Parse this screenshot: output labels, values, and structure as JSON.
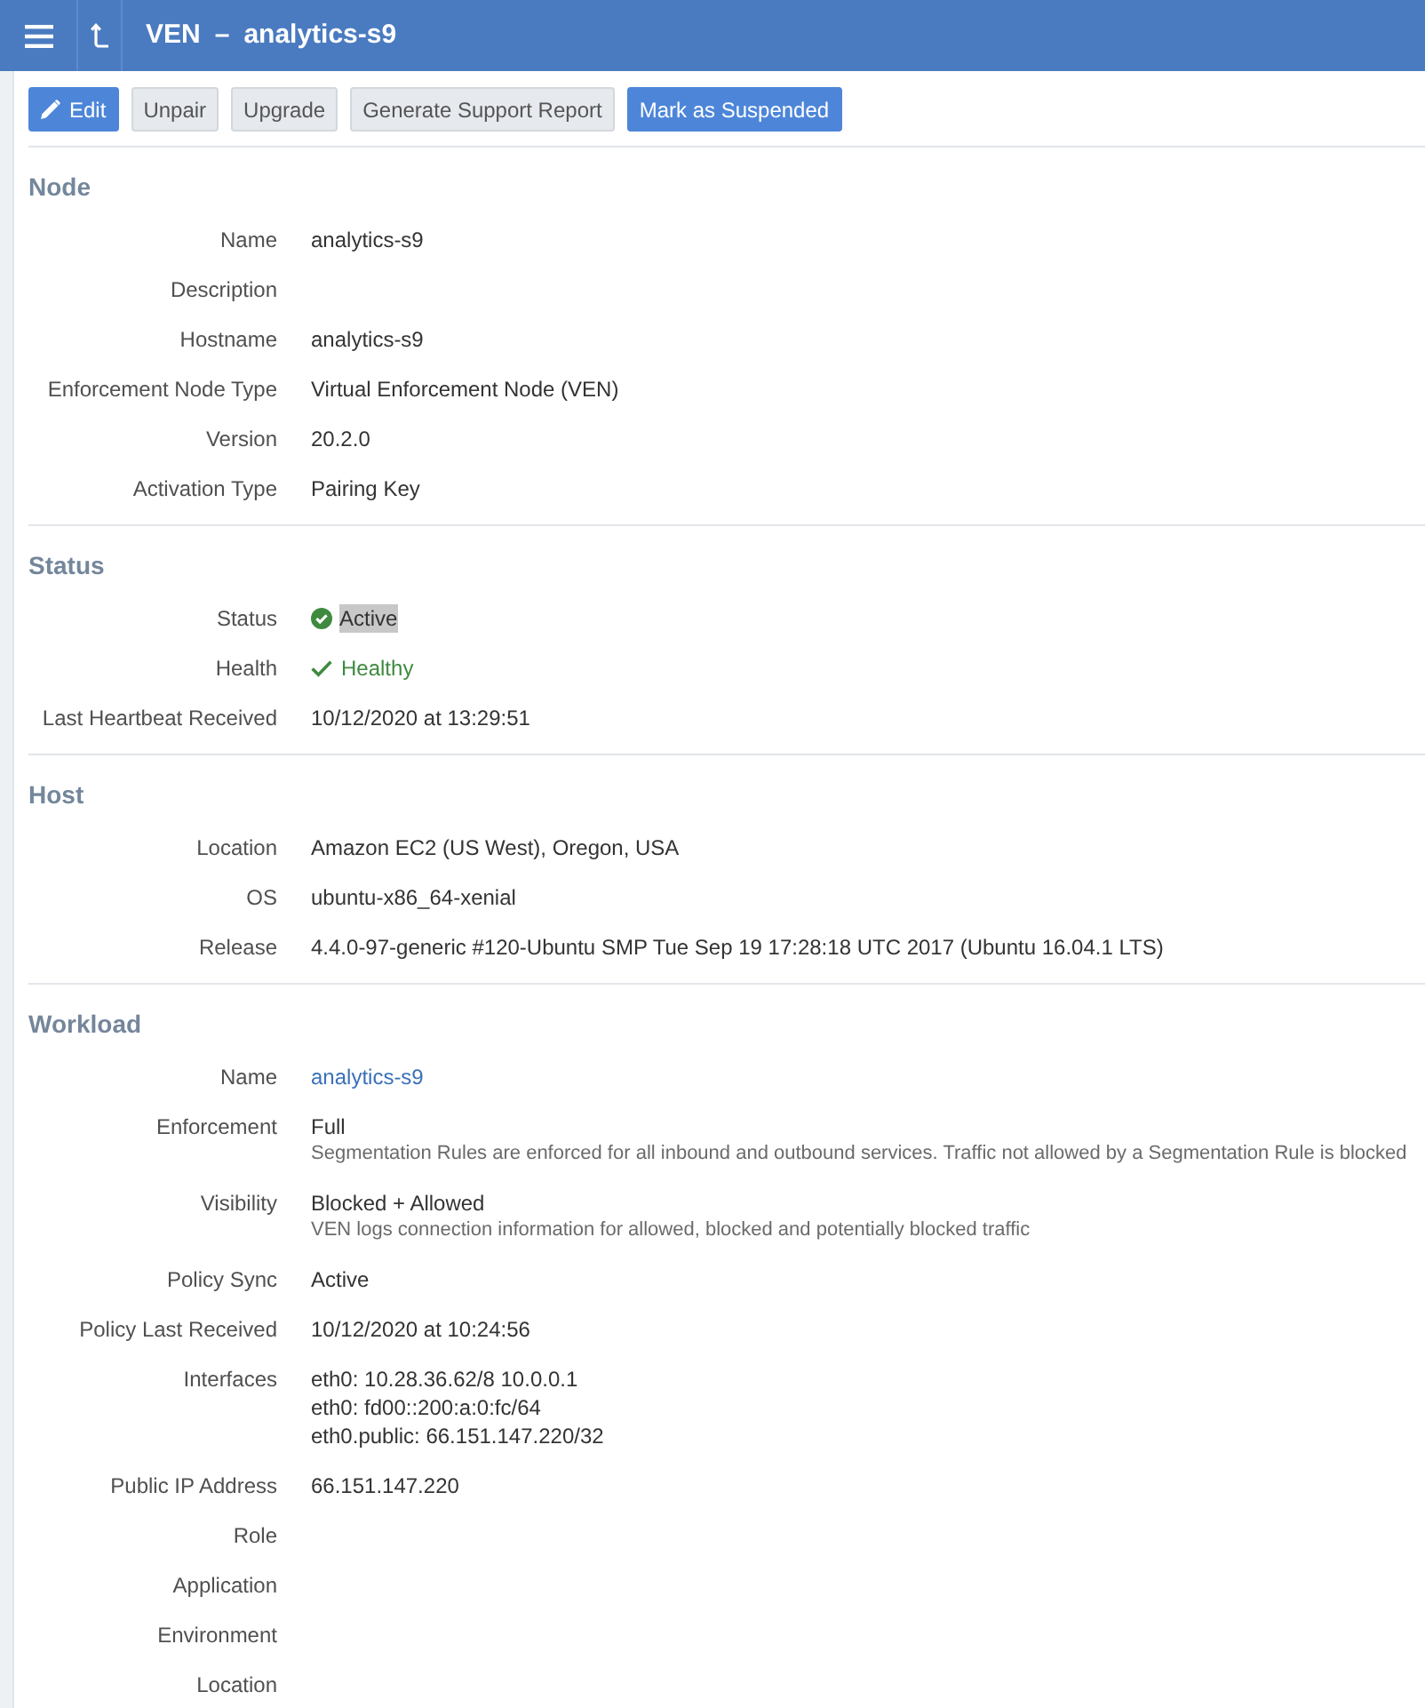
{
  "header": {
    "title": "VEN",
    "separator": "–",
    "subtitle": "analytics-s9"
  },
  "toolbar": [
    {
      "label": "Edit",
      "kind": "primary",
      "icon": true
    },
    {
      "label": "Unpair",
      "kind": "secondary"
    },
    {
      "label": "Upgrade",
      "kind": "secondary"
    },
    {
      "label": "Generate Support Report",
      "kind": "secondary"
    },
    {
      "label": "Mark as Suspended",
      "kind": "primary"
    }
  ],
  "sections": [
    {
      "title": "Node",
      "fields": [
        {
          "kind": "text",
          "label": "Name",
          "value": "analytics-s9"
        },
        {
          "kind": "text",
          "label": "Description"
        },
        {
          "kind": "text",
          "label": "Hostname",
          "value": "analytics-s9"
        },
        {
          "kind": "text",
          "label": "Enforcement Node Type",
          "value": "Virtual Enforcement Node (VEN)"
        },
        {
          "kind": "text",
          "label": "Version",
          "value": "20.2.0"
        },
        {
          "kind": "text",
          "label": "Activation Type",
          "value": "Pairing Key"
        }
      ]
    },
    {
      "title": "Status",
      "fields": [
        {
          "kind": "status",
          "label": "Status",
          "value": "Active",
          "highlighted": true
        },
        {
          "kind": "health",
          "label": "Health",
          "value": "Healthy"
        },
        {
          "kind": "text",
          "label": "Last Heartbeat Received",
          "value": "10/12/2020 at 13:29:51"
        }
      ]
    },
    {
      "title": "Host",
      "fields": [
        {
          "kind": "text",
          "label": "Location",
          "value": "Amazon EC2 (US West), Oregon, USA"
        },
        {
          "kind": "text",
          "label": "OS",
          "value": "ubuntu-x86_64-xenial"
        },
        {
          "kind": "text",
          "label": "Release",
          "value": "4.4.0-97-generic #120-Ubuntu SMP Tue Sep 19 17:28:18 UTC 2017 (Ubuntu 16.04.1 LTS)"
        }
      ]
    },
    {
      "title": "Workload",
      "fields": [
        {
          "kind": "link",
          "label": "Name",
          "value": "analytics-s9"
        },
        {
          "kind": "text",
          "label": "Enforcement",
          "value": "Full",
          "note": "Segmentation Rules are enforced for all inbound and outbound services. Traffic not allowed by a Segmentation Rule is blocked"
        },
        {
          "kind": "text",
          "label": "Visibility",
          "value": "Blocked + Allowed",
          "note": "VEN logs connection information for allowed, blocked and potentially blocked traffic"
        },
        {
          "kind": "text",
          "label": "Policy Sync",
          "value": "Active"
        },
        {
          "kind": "text",
          "label": "Policy Last Received",
          "value": "10/12/2020 at 10:24:56"
        },
        {
          "kind": "lines",
          "label": "Interfaces",
          "lines": [
            "eth0: 10.28.36.62/8 10.0.0.1",
            "eth0: fd00::200:a:0:fc/64",
            "eth0.public: 66.151.147.220/32"
          ]
        },
        {
          "kind": "text",
          "label": "Public IP Address",
          "value": "66.151.147.220"
        },
        {
          "kind": "text",
          "label": "Role"
        },
        {
          "kind": "text",
          "label": "Application"
        },
        {
          "kind": "text",
          "label": "Environment"
        },
        {
          "kind": "text",
          "label": "Location"
        }
      ]
    }
  ]
}
